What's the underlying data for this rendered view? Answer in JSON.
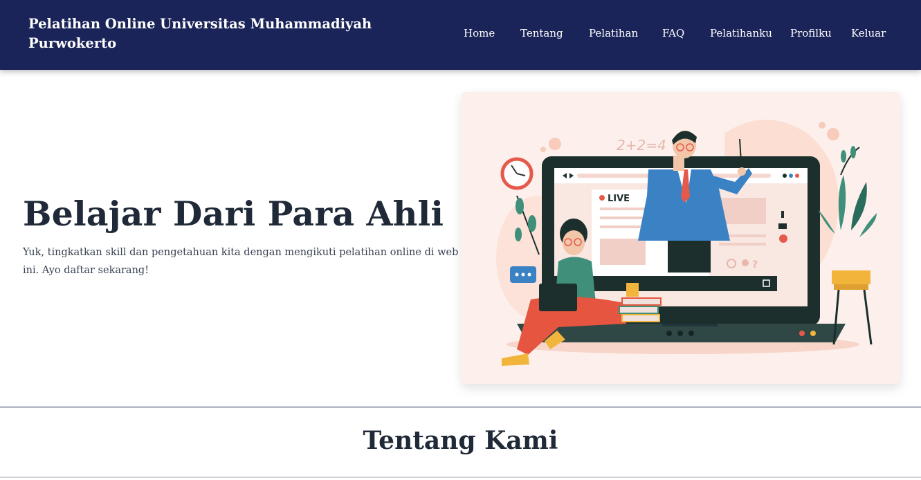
{
  "navbar": {
    "brand": "Pelatihan Online Universitas Muhammadiyah Purwokerto",
    "items": [
      {
        "label": "Home"
      },
      {
        "label": "Tentang"
      },
      {
        "label": "Pelatihan"
      },
      {
        "label": "FAQ"
      },
      {
        "label": "Pelatihanku"
      },
      {
        "label": "Profilku"
      },
      {
        "label": "Keluar"
      }
    ]
  },
  "hero": {
    "title": "Belajar Dari Para Ahli",
    "text": "Yuk, tingkatkan skill dan pengetahuan kita dengan mengikuti pelatihan online di web ini. Ayo daftar sekarang!",
    "illustration": {
      "equation": "2+2=4",
      "live_badge": "LIVE"
    }
  },
  "about": {
    "title": "Tentang Kami"
  },
  "colors": {
    "navbar_bg": "#1a2459",
    "illustration_bg": "#fdf0ec"
  }
}
